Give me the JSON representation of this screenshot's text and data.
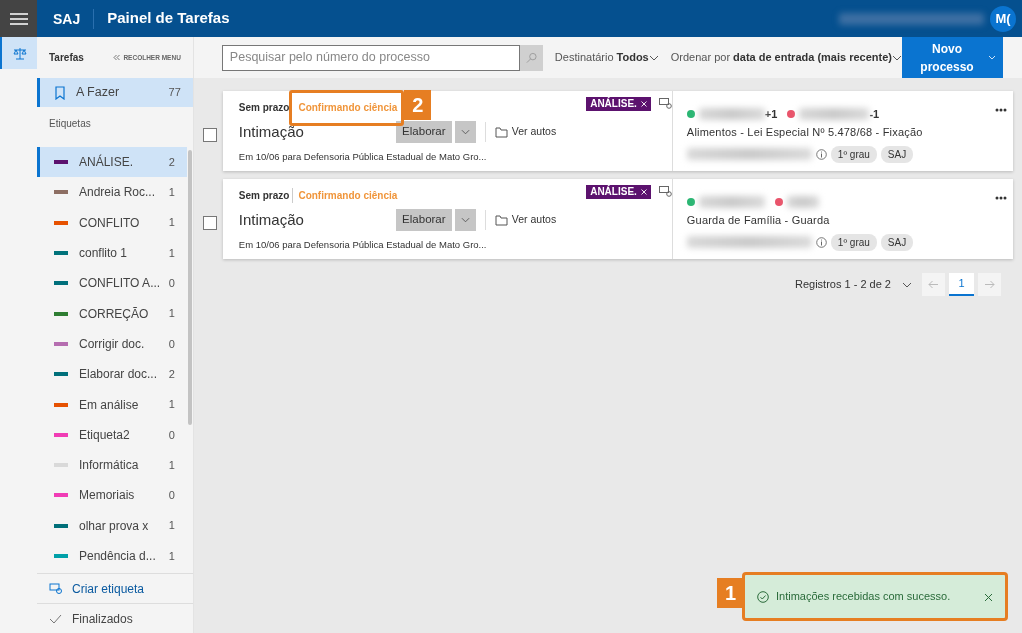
{
  "app": {
    "logo": "SAJ",
    "title": "Painel de Tarefas",
    "avatar": "M("
  },
  "sidebar": {
    "header": "Tarefas",
    "collapse": "RECOLHER MENU",
    "todo": {
      "label": "A Fazer",
      "count": "77",
      "selected": true
    },
    "labels_heading": "Etiquetas",
    "labels": [
      {
        "name": "ANÁLISE.",
        "count": "2",
        "color": "#5c126e",
        "selected": true
      },
      {
        "name": "Andreia Roc...",
        "count": "1",
        "color": "#8d6e63",
        "selected": false
      },
      {
        "name": "CONFLITO",
        "count": "1",
        "color": "#e65100",
        "selected": false
      },
      {
        "name": "conflito 1",
        "count": "1",
        "color": "#00727a",
        "selected": false
      },
      {
        "name": "CONFLITO A...",
        "count": "0",
        "color": "#006f7b",
        "selected": false
      },
      {
        "name": "CORREÇÃO",
        "count": "1",
        "color": "#2e7d32",
        "selected": false
      },
      {
        "name": "Corrigir doc.",
        "count": "0",
        "color": "#b56db0",
        "selected": false
      },
      {
        "name": "Elaborar doc...",
        "count": "2",
        "color": "#006f7a",
        "selected": false
      },
      {
        "name": "Em análise",
        "count": "1",
        "color": "#e65101",
        "selected": false
      },
      {
        "name": "Etiqueta2",
        "count": "0",
        "color": "#f03cb4",
        "selected": false
      },
      {
        "name": "Informática",
        "count": "1",
        "color": "#d9d9d9",
        "selected": false
      },
      {
        "name": "Memoriais",
        "count": "0",
        "color": "#f03cb5",
        "selected": false
      },
      {
        "name": "olhar prova x",
        "count": "1",
        "color": "#006f79",
        "selected": false
      },
      {
        "name": "Pendência d...",
        "count": "1",
        "color": "#00a0a8",
        "selected": false
      }
    ],
    "create": "Criar etiqueta",
    "finished": "Finalizados"
  },
  "toolbar": {
    "search": {
      "placeholder": "Pesquisar pelo número do processo"
    },
    "recipient": {
      "label": "Destinatário",
      "value": "Todos"
    },
    "sort": {
      "label": "Ordenar por",
      "value": "data de entrada (mais recente)"
    },
    "new_button": "Novo processo"
  },
  "tasks": [
    {
      "deadline": "Sem prazo",
      "status": "Confirmando ciência",
      "type": "Intimação",
      "action": "Elaborar",
      "autos": "Ver autos",
      "recipient": "Em 10/06 para Defensoria Pública Estadual de Mato Gro...",
      "tag": "ANÁLISE.",
      "checked": false,
      "callout": "2",
      "parties": [
        {
          "kind": "active",
          "extra": "+1"
        },
        {
          "kind": "passive",
          "extra": "-1"
        }
      ],
      "subject": "Alimentos - Lei Especial Nº 5.478/68 - Fixação",
      "chips": [
        "1º grau",
        "SAJ"
      ]
    },
    {
      "deadline": "Sem prazo",
      "status": "Confirmando ciência",
      "type": "Intimação",
      "action": "Elaborar",
      "autos": "Ver autos",
      "recipient": "Em 10/06 para Defensoria Pública Estadual de Mato Gro...",
      "tag": "ANÁLISE.",
      "checked": false,
      "parties": [
        {
          "kind": "active"
        },
        {
          "kind": "passive"
        }
      ],
      "subject": "Guarda de Família - Guarda",
      "chips": [
        "1º grau",
        "SAJ"
      ]
    }
  ],
  "pagination": {
    "summary": "Registros 1 - 2 de 2",
    "pages": [
      {
        "label": "1",
        "selected": true
      }
    ]
  },
  "toast": {
    "message": "Intimações recebidas com sucesso.",
    "callout": "1"
  }
}
